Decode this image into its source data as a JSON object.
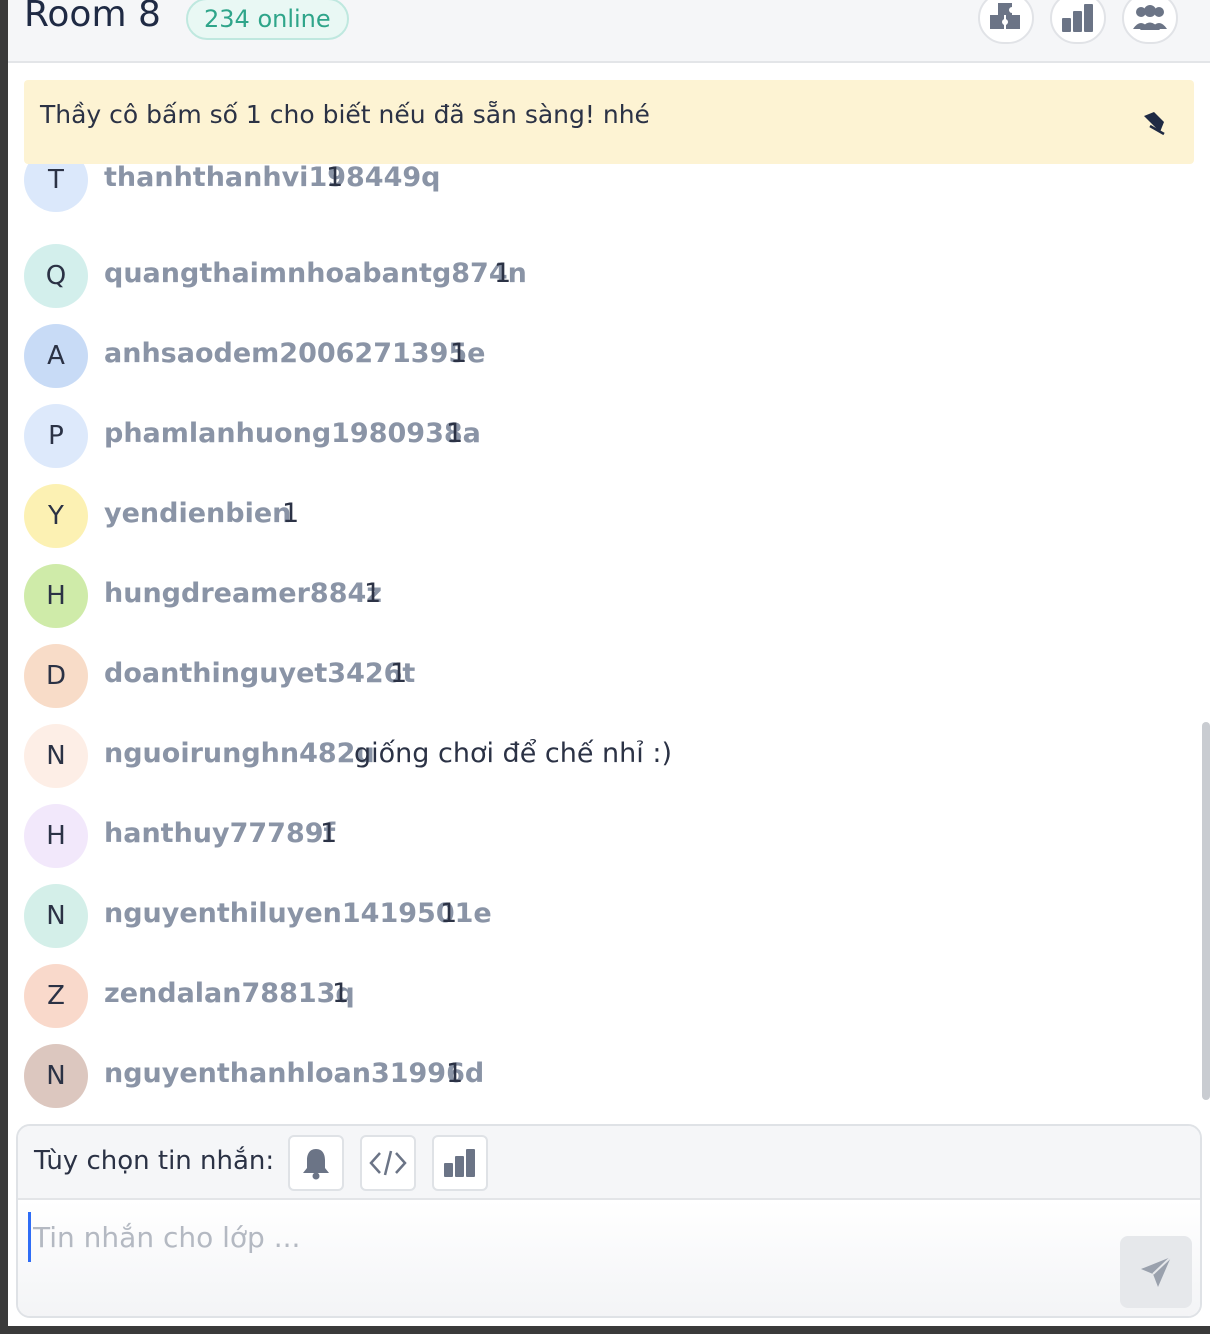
{
  "header": {
    "room_title": "Room 8",
    "online_count": "234 online"
  },
  "pinned": {
    "text": "Thầy cô bấm số 1 cho biết nếu đã sẵn sàng! nhé"
  },
  "messages": [
    {
      "initial": "T",
      "username": "thanhthanhvi198449q",
      "text": "1",
      "avatar_color": "#dbe8fb"
    },
    {
      "initial": "Q",
      "username": "quangthaimnhoabantg874n",
      "text": "1",
      "avatar_color": "#d3efec"
    },
    {
      "initial": "A",
      "username": "anhsaodem2006271395e",
      "text": "1",
      "avatar_color": "#c8dbf6"
    },
    {
      "initial": "P",
      "username": "phamlanhuong1980938a",
      "text": "1",
      "avatar_color": "#dde9fb"
    },
    {
      "initial": "Y",
      "username": "yendienbien",
      "text": "1",
      "avatar_color": "#fcf1b3"
    },
    {
      "initial": "H",
      "username": "hungdreamer884z",
      "text": "1",
      "avatar_color": "#cfeba9"
    },
    {
      "initial": "D",
      "username": "doanthinguyet3426t",
      "text": "1",
      "avatar_color": "#f8dcc8"
    },
    {
      "initial": "N",
      "username": "nguoirunghn482u",
      "text": "giống chơi để chế nhỉ :)",
      "avatar_color": "#fdeee6"
    },
    {
      "initial": "H",
      "username": "hanthuy77789f",
      "text": "1",
      "avatar_color": "#f2e8fb"
    },
    {
      "initial": "N",
      "username": "nguyenthiluyen1419501e",
      "text": "1",
      "avatar_color": "#d4efe9"
    },
    {
      "initial": "Z",
      "username": "zendalan78813q",
      "text": "1",
      "avatar_color": "#f9d9cb"
    },
    {
      "initial": "N",
      "username": "nguyenthanhloan31996d",
      "text": "1",
      "avatar_color": "#dcc7bf"
    }
  ],
  "composer": {
    "options_label": "Tùy chọn tin nhắn:",
    "placeholder": "Tin nhắn cho lớp ..."
  },
  "icons": {
    "header": [
      "puzzle-icon",
      "bar-chart-icon",
      "users-icon"
    ],
    "pinned": "pin-icon",
    "options": [
      "bell-icon",
      "code-icon",
      "bar-chart-icon"
    ],
    "send": "send-icon"
  },
  "colors": {
    "accent_teal": "#2fa58a",
    "pinned_bg": "#fdf3d3",
    "username_gray": "#8a94a6",
    "text_dark": "#2b3245"
  }
}
